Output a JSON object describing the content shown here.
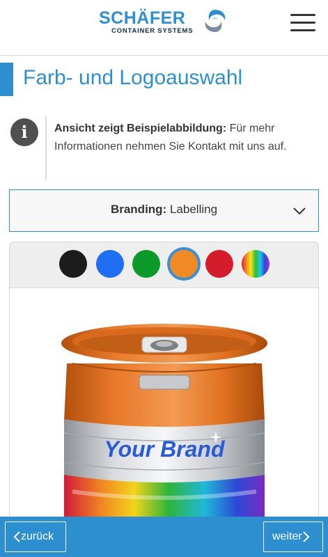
{
  "header": {
    "brand_word": "SCHÄFER",
    "brand_sub": "CONTAINER SYSTEMS",
    "menu_icon": "hamburger-menu-icon"
  },
  "page": {
    "title": "Farb- und Logoauswahl"
  },
  "info": {
    "icon": "info-icon",
    "bold": "Ansicht zeigt Beispielabbildung:",
    "text": " Für mehr Informationen nehmen Sie Kontakt mit uns auf."
  },
  "branding_select": {
    "label": "Branding:",
    "value": "Labelling",
    "icon": "chevron-down-icon"
  },
  "colors": {
    "swatches": [
      {
        "name": "schwarz",
        "hex": "#1c1c1c"
      },
      {
        "name": "blau",
        "hex": "#1f6ff2"
      },
      {
        "name": "grün",
        "hex": "#0c9a2a"
      },
      {
        "name": "orange",
        "hex": "#f08a24",
        "selected": true
      },
      {
        "name": "rot",
        "hex": "#d41c2a"
      },
      {
        "name": "regenbogen",
        "hex": "rainbow"
      }
    ],
    "accent": "#2e8fd0"
  },
  "keg_image": {
    "label_text": "Your Brand"
  },
  "navigation": {
    "prev_label": "zurück",
    "next_label": "weiter"
  }
}
